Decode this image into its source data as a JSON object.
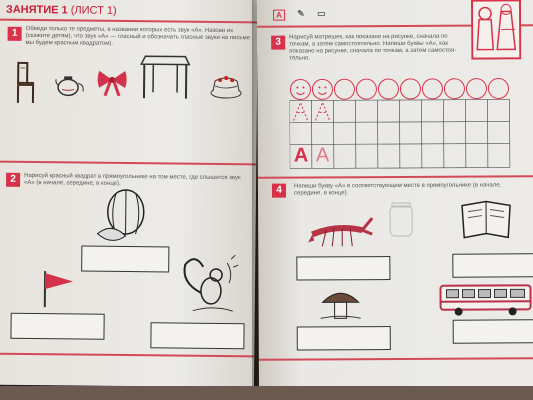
{
  "left_page": {
    "title": "ЗАНЯТИЕ 1",
    "title_suffix": "(ЛИСТ 1)",
    "task1": {
      "number": "1",
      "lines": [
        "Обведи только те предметы, в названии которых есть звук «А». Назови их",
        "(скажите детям), что звук «А» — гласный и обозначать гласные звуки на письме",
        "мы будем красным квадратом)."
      ],
      "items": [
        "chair-icon",
        "teapot-icon",
        "bow-icon",
        "table-icon",
        "cake-icon"
      ]
    },
    "task2": {
      "number": "2",
      "lines": [
        "Нарисуй красный квадрат в прямоугольнике на том месте, где слышится звук",
        "«А» (в начале, середине, в конце)."
      ],
      "items": [
        "watermelon-icon",
        "squirrel-icon",
        "flag-icon"
      ]
    }
  },
  "right_page": {
    "header_symbols": [
      "A",
      "✎",
      "▭"
    ],
    "task3": {
      "number": "3",
      "lines": [
        "Нарисуй матрешек, как показано на рисунке, сначала по",
        "точкам, а затем самостоятельно. Напиши буквы «А», как",
        "показано на рисунке, сначала по точкам, а затем самостоя-",
        "тельно."
      ],
      "letters": [
        "A",
        "A"
      ]
    },
    "task4": {
      "number": "4",
      "lines": [
        "Напиши букву «А» в соответствующем месте в прямоугольнике (в начале,",
        "середине, в конце)."
      ],
      "items": [
        "crayfish-icon",
        "jar-icon",
        "book-icon",
        "mushroom-icon",
        "bus-icon"
      ]
    }
  },
  "colors": {
    "accent": "#d7324a",
    "paper": "#ecebe7",
    "ink": "#333333"
  }
}
